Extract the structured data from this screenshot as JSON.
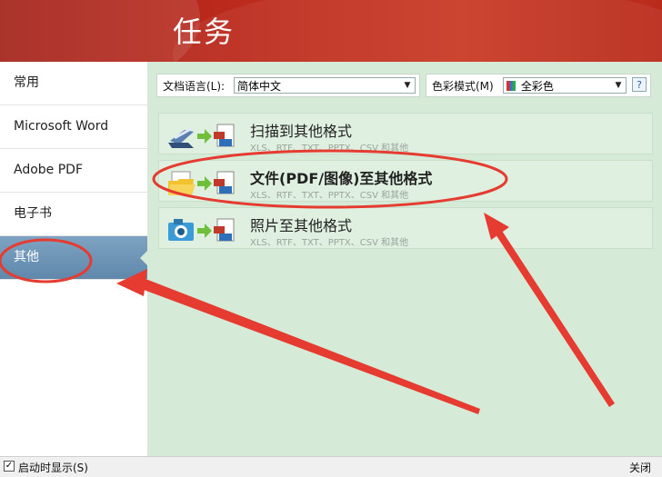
{
  "header": {
    "title": "任务"
  },
  "sidebar": {
    "items": [
      {
        "label": "常用"
      },
      {
        "label": "Microsoft Word"
      },
      {
        "label": "Adobe PDF"
      },
      {
        "label": "电子书"
      },
      {
        "label": "其他",
        "active": true
      }
    ]
  },
  "toolbar": {
    "doc_lang_label": "文档语言(L):",
    "doc_lang_value": "简体中文",
    "color_mode_label": "色彩模式(M)",
    "color_mode_value": "全彩色",
    "help_label": "?"
  },
  "tasks": [
    {
      "title": "扫描到其他格式",
      "subtitle": "XLS、RTF、TXT、PPTX、CSV 和其他"
    },
    {
      "title": "文件(PDF/图像)至其他格式",
      "subtitle": "XLS、RTF、TXT、PPTX、CSV 和其他"
    },
    {
      "title": "照片至其他格式",
      "subtitle": "XLS、RTF、TXT、PPTX、CSV 和其他"
    }
  ],
  "footer": {
    "startup_label": "启动时显示(S)",
    "close_label": "关闭"
  },
  "colors": {
    "header_red": "#b92a1a",
    "sidebar_active": "#6a90b2",
    "content_green": "#d5ebd7",
    "annotation_red": "#e53b30"
  }
}
